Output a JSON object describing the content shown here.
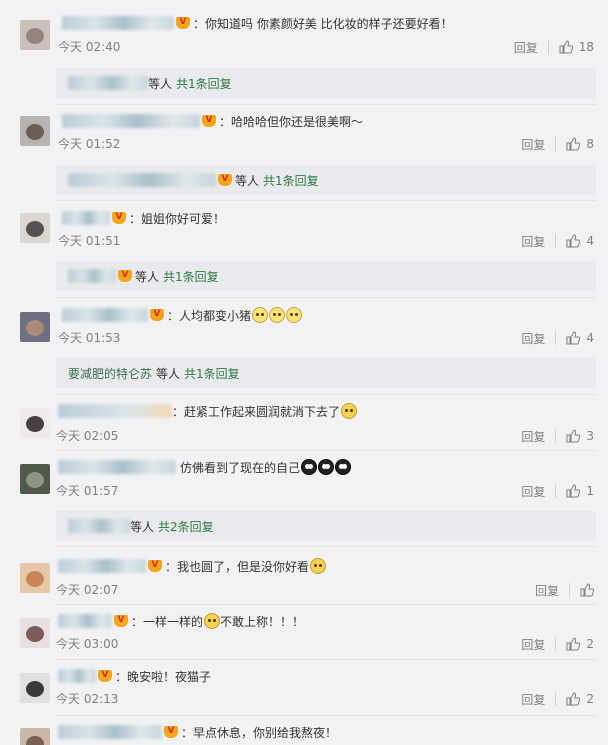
{
  "ui": {
    "reply_label": "回复",
    "has_replies_suffix": "等人"
  },
  "comments": [
    {
      "text": "：你知道吗  你素颜好美 比化妆的样子还要好看！",
      "time": "今天 02:40",
      "likes": "18",
      "reply_summary": "共1条回复"
    },
    {
      "text": "：哈哈哈但你还是很美啊～",
      "time": "今天 01:52",
      "likes": "8",
      "reply_summary": "共1条回复"
    },
    {
      "text": "：姐姐你好可爱！",
      "time": "今天 01:51",
      "likes": "4",
      "reply_summary": "共1条回复"
    },
    {
      "text": "：人均都变小猪",
      "time": "今天 01:53",
      "likes": "4",
      "reply_user": "要减肥的特仑苏",
      "reply_summary": "共1条回复"
    },
    {
      "text": "：赶紧工作起来圆润就消下去了",
      "time": "今天 02:05",
      "likes": "3"
    },
    {
      "text": "仿佛看到了现在的自己",
      "time": "今天 01:57",
      "likes": "1",
      "reply_summary": "共2条回复"
    },
    {
      "text": "：我也圆了，但是没你好看",
      "time": "今天 02:07",
      "likes": ""
    },
    {
      "text": "：一样一样的",
      "text2": "不敢上称！！！",
      "time": "今天 03:00",
      "likes": "2"
    },
    {
      "text": "：晚安啦！夜猫子",
      "time": "今天 02:13",
      "likes": "2"
    },
    {
      "text": "：早点休息，你别给我熬夜！",
      "time": "",
      "likes": ""
    }
  ],
  "colors": {
    "link_green": "#2d7a3e",
    "vip_gold": "#f5a51c",
    "muted": "#808080"
  }
}
